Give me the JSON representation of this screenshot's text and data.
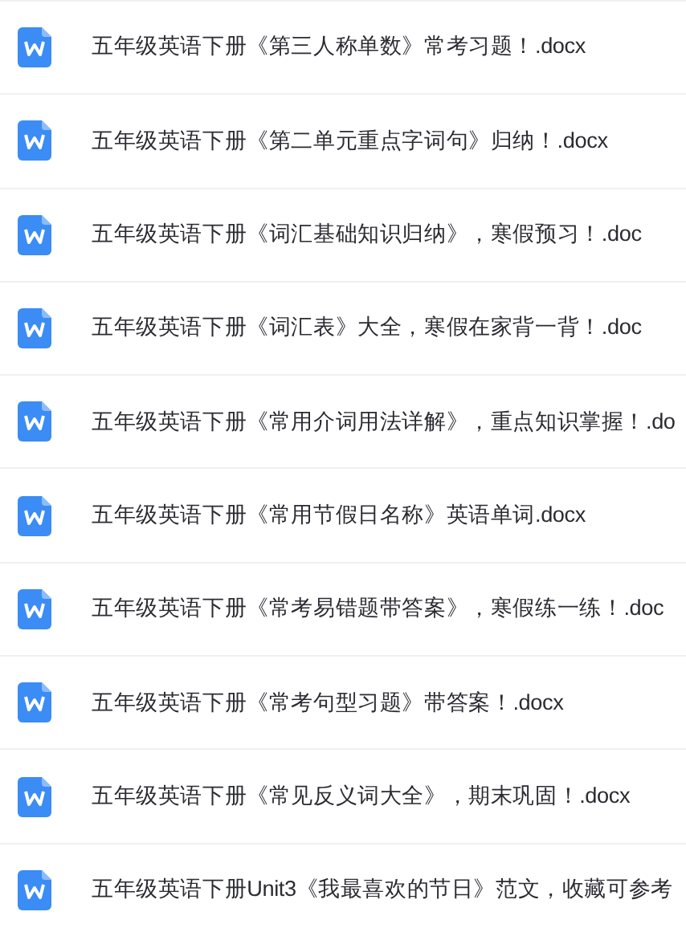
{
  "files": [
    {
      "name": "五年级英语下册《第三人称单数》常考习题！.docx"
    },
    {
      "name": "五年级英语下册《第二单元重点字词句》归纳！.docx"
    },
    {
      "name": "五年级英语下册《词汇基础知识归纳》，寒假预习！.doc"
    },
    {
      "name": "五年级英语下册《词汇表》大全，寒假在家背一背！.doc"
    },
    {
      "name": "五年级英语下册《常用介词用法详解》，重点知识掌握！.do"
    },
    {
      "name": "五年级英语下册《常用节假日名称》英语单词.docx"
    },
    {
      "name": "五年级英语下册《常考易错题带答案》，寒假练一练！.doc"
    },
    {
      "name": "五年级英语下册《常考句型习题》带答案！.docx"
    },
    {
      "name": "五年级英语下册《常见反义词大全》，期末巩固！.docx"
    },
    {
      "name": "五年级英语下册Unit3《我最喜欢的节日》范文，收藏可参考"
    }
  ]
}
